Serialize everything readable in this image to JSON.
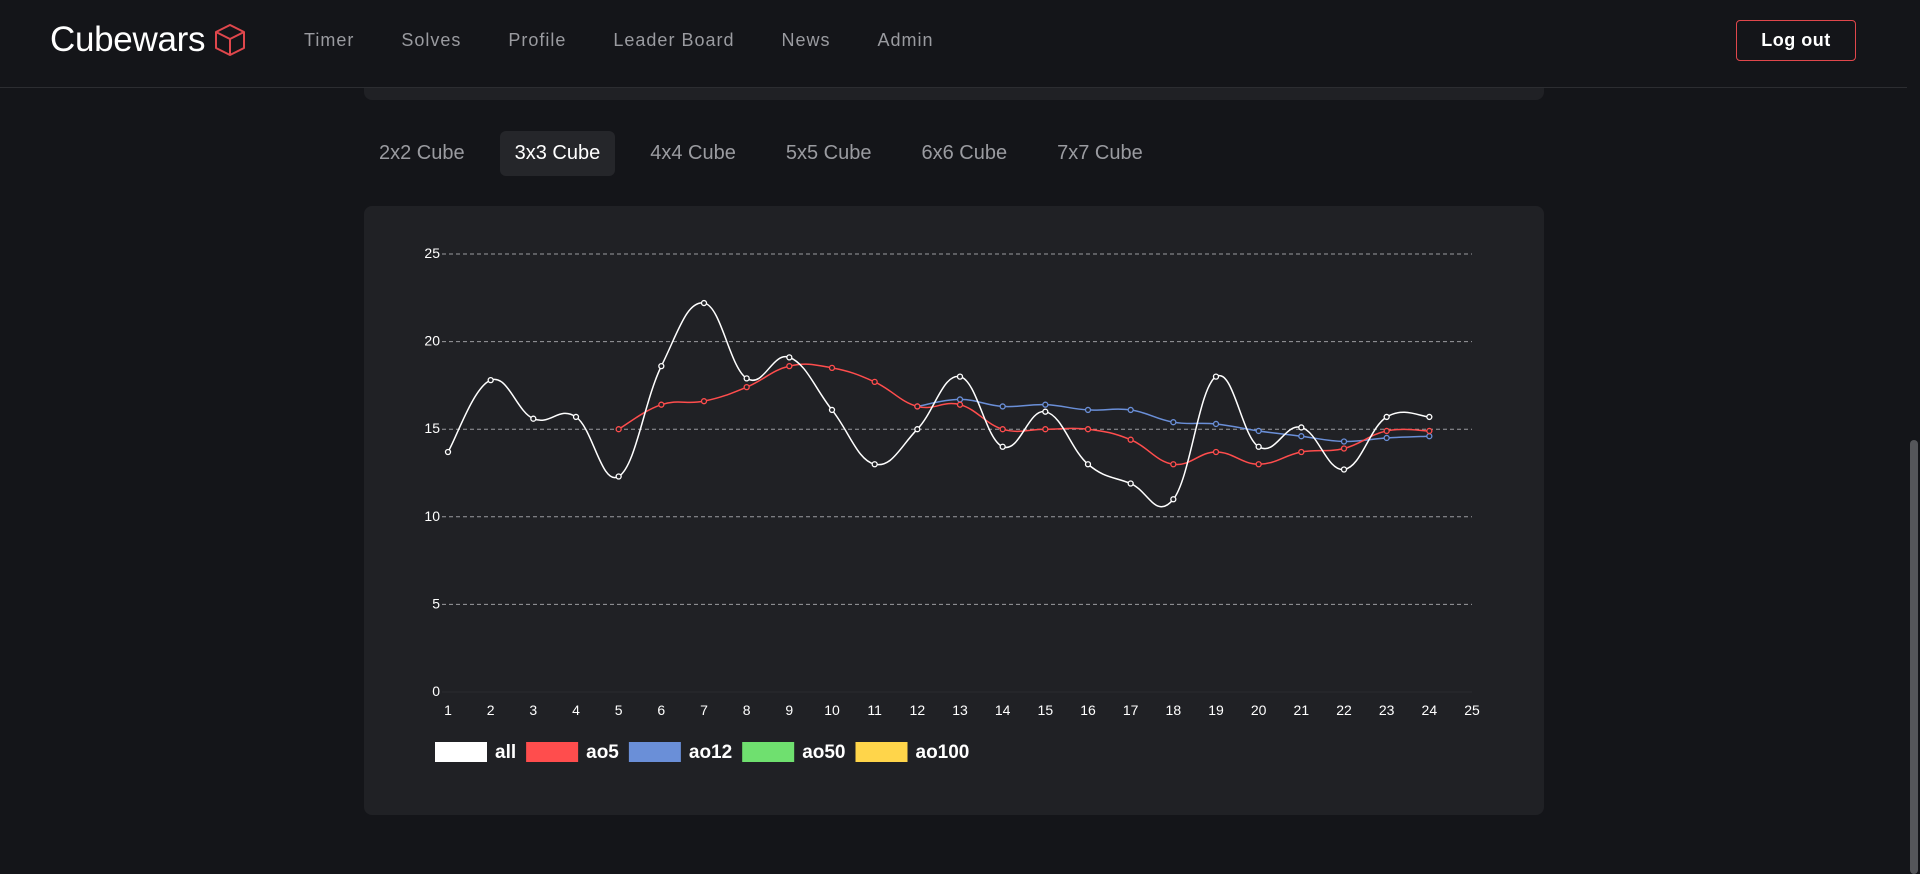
{
  "brand": {
    "name": "Cubewars",
    "icon": "cube-icon",
    "icon_color": "#e0474c"
  },
  "nav": {
    "links": [
      "Timer",
      "Solves",
      "Profile",
      "Leader Board",
      "News",
      "Admin"
    ],
    "logout_label": "Log out"
  },
  "tabs": [
    {
      "label": "2x2 Cube",
      "active": false
    },
    {
      "label": "3x3 Cube",
      "active": true
    },
    {
      "label": "4x4 Cube",
      "active": false
    },
    {
      "label": "5x5 Cube",
      "active": false
    },
    {
      "label": "6x6 Cube",
      "active": false
    },
    {
      "label": "7x7 Cube",
      "active": false
    }
  ],
  "chart_data": {
    "type": "line",
    "x": [
      1,
      2,
      3,
      4,
      5,
      6,
      7,
      8,
      9,
      10,
      11,
      12,
      13,
      14,
      15,
      16,
      17,
      18,
      19,
      20,
      21,
      22,
      23,
      24,
      25
    ],
    "ylim": [
      0,
      25
    ],
    "yticks": [
      0,
      5,
      10,
      15,
      20,
      25
    ],
    "grid": true,
    "legend_position": "bottom-left",
    "series": [
      {
        "name": "all",
        "color": "#ffffff",
        "x_start": 1,
        "values": [
          13.7,
          17.8,
          15.6,
          15.7,
          12.3,
          18.6,
          22.2,
          17.9,
          19.1,
          16.1,
          13.0,
          15.0,
          18.0,
          14.0,
          16.0,
          13.0,
          11.9,
          11.0,
          18.0,
          14.0,
          15.1,
          12.7,
          15.7,
          15.7
        ]
      },
      {
        "name": "ao5",
        "color": "#ff4d4d",
        "x_start": 5,
        "values": [
          15.0,
          16.4,
          16.6,
          17.4,
          18.6,
          18.5,
          17.7,
          16.3,
          16.4,
          15.0,
          15.0,
          15.0,
          14.4,
          13.0,
          13.7,
          13.0,
          13.7,
          13.9,
          14.9,
          14.9
        ]
      },
      {
        "name": "ao12",
        "color": "#6a8fd8",
        "x_start": 12,
        "values": [
          16.3,
          16.7,
          16.3,
          16.4,
          16.1,
          16.1,
          15.4,
          15.3,
          14.9,
          14.6,
          14.3,
          14.5,
          14.6
        ]
      },
      {
        "name": "ao50",
        "color": "#6fe06f",
        "x_start": 50,
        "values": []
      },
      {
        "name": "ao100",
        "color": "#ffd54a",
        "x_start": 100,
        "values": []
      }
    ]
  }
}
